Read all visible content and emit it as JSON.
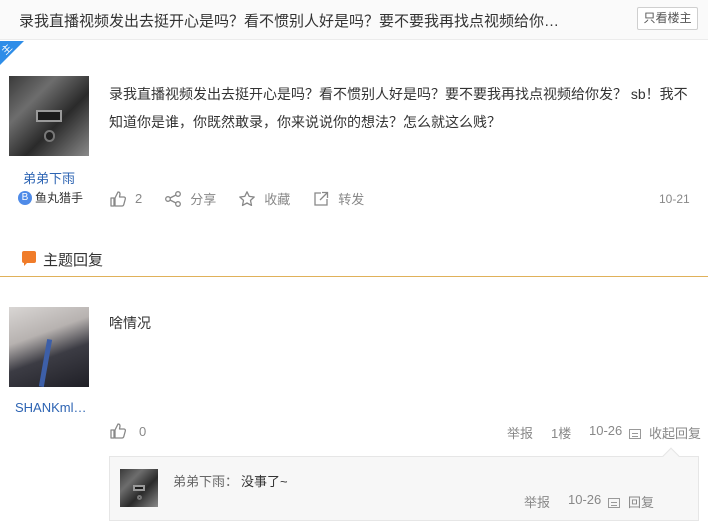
{
  "topbar": {
    "title": "录我直播视频发出去挺开心是吗？看不惯别人好是吗？要不要我再找点视频给你…",
    "only_op_label": "只看楼主"
  },
  "op_post": {
    "corner_label": "主",
    "author": "弟弟下雨",
    "badge_letter": "B",
    "badge_text": "鱼丸猎手",
    "text": "录我直播视频发出去挺开心是吗？看不惯别人好是吗？要不要我再找点视频给你发？ sb！我不知道你是谁，你既然敢录，你来说说你的想法？怎么就这么贱？",
    "like_count": "2",
    "share_label": "分享",
    "fav_label": "收藏",
    "forward_label": "转发",
    "date": "10-21"
  },
  "replies_section": {
    "title": "主题回复"
  },
  "reply": {
    "author": "SHANKml…",
    "text": "啥情况",
    "like_count": "0",
    "report_label": "举报",
    "floor": "1楼",
    "date": "10-26",
    "collapse_label": "收起回复",
    "sub": {
      "author": "弟弟下雨：",
      "text": "没事了~",
      "report_label": "举报",
      "date": "10-26",
      "reply_label": "回复"
    }
  }
}
